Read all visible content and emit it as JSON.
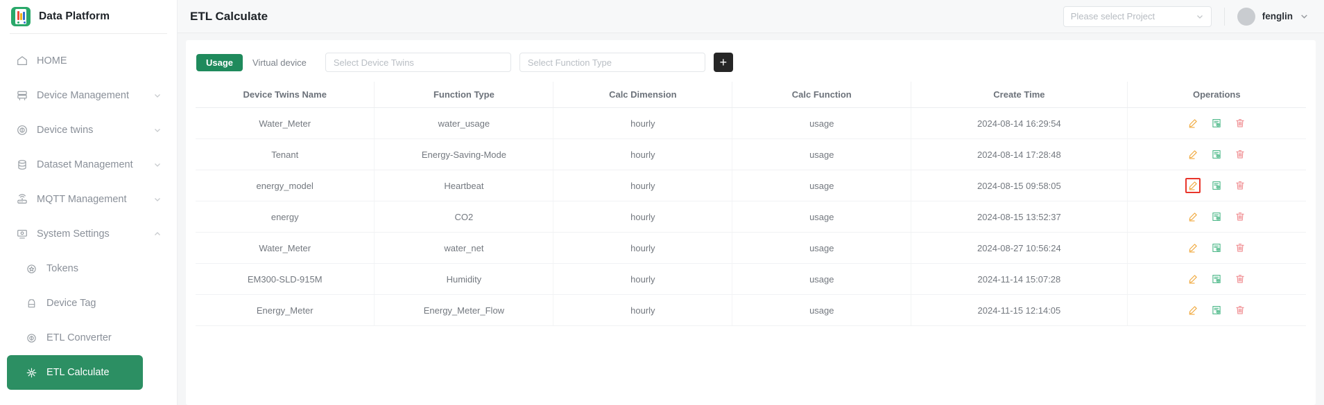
{
  "brand": {
    "title": "Data Platform",
    "logo_icon": "bar-chart-logo-icon"
  },
  "sidebar": {
    "items": [
      {
        "label": "HOME",
        "icon": "home-icon",
        "expandable": false,
        "active": false,
        "child": false
      },
      {
        "label": "Device Management",
        "icon": "server-icon",
        "expandable": true,
        "active": false,
        "child": false
      },
      {
        "label": "Device twins",
        "icon": "twins-icon",
        "expandable": true,
        "active": false,
        "child": false
      },
      {
        "label": "Dataset Management",
        "icon": "database-icon",
        "expandable": true,
        "active": false,
        "child": false
      },
      {
        "label": "MQTT Management",
        "icon": "router-icon",
        "expandable": true,
        "active": false,
        "child": false
      },
      {
        "label": "System Settings",
        "icon": "monitor-icon",
        "expandable": true,
        "active": false,
        "child": false,
        "expanded": true
      },
      {
        "label": "Tokens",
        "icon": "token-star-icon",
        "expandable": false,
        "active": false,
        "child": true
      },
      {
        "label": "Device Tag",
        "icon": "tag-icon",
        "expandable": false,
        "active": false,
        "child": true
      },
      {
        "label": "ETL Converter",
        "icon": "converter-icon",
        "expandable": false,
        "active": false,
        "child": true
      },
      {
        "label": "ETL Calculate",
        "icon": "calculate-icon",
        "expandable": false,
        "active": true,
        "child": true
      }
    ],
    "active_color": "#2c8f63"
  },
  "topbar": {
    "page_title": "ETL Calculate",
    "project_select": {
      "placeholder": "Please select Project",
      "value": ""
    },
    "user": {
      "name": "fenglin"
    }
  },
  "toolbar": {
    "tabs": [
      {
        "label": "Usage",
        "active": true
      },
      {
        "label": "Virtual device",
        "active": false
      }
    ],
    "device_twins_filter": {
      "placeholder": "Select Device Twins",
      "value": ""
    },
    "function_type_filter": {
      "placeholder": "Select Function Type",
      "value": ""
    },
    "add_button_label": "+"
  },
  "table": {
    "columns": [
      "Device Twins Name",
      "Function Type",
      "Calc Dimension",
      "Calc Function",
      "Create Time",
      "Operations"
    ],
    "rows": [
      {
        "device_twins_name": "Water_Meter",
        "function_type": "water_usage",
        "calc_dimension": "hourly",
        "calc_function": "usage",
        "create_time": "2024-08-14 16:29:54",
        "edit_highlighted": false
      },
      {
        "device_twins_name": "Tenant",
        "function_type": "Energy-Saving-Mode",
        "calc_dimension": "hourly",
        "calc_function": "usage",
        "create_time": "2024-08-14 17:28:48",
        "edit_highlighted": false
      },
      {
        "device_twins_name": "energy_model",
        "function_type": "Heartbeat",
        "calc_dimension": "hourly",
        "calc_function": "usage",
        "create_time": "2024-08-15 09:58:05",
        "edit_highlighted": true
      },
      {
        "device_twins_name": "energy",
        "function_type": "CO2",
        "calc_dimension": "hourly",
        "calc_function": "usage",
        "create_time": "2024-08-15 13:52:37",
        "edit_highlighted": false
      },
      {
        "device_twins_name": "Water_Meter",
        "function_type": "water_net",
        "calc_dimension": "hourly",
        "calc_function": "usage",
        "create_time": "2024-08-27 10:56:24",
        "edit_highlighted": false
      },
      {
        "device_twins_name": "EM300-SLD-915M",
        "function_type": "Humidity",
        "calc_dimension": "hourly",
        "calc_function": "usage",
        "create_time": "2024-11-14 15:07:28",
        "edit_highlighted": false
      },
      {
        "device_twins_name": "Energy_Meter",
        "function_type": "Energy_Meter_Flow",
        "calc_dimension": "hourly",
        "calc_function": "usage",
        "create_time": "2024-11-15 12:14:05",
        "edit_highlighted": false
      }
    ],
    "operation_icons": [
      "edit-pencil-icon",
      "view-detail-icon",
      "delete-trash-icon"
    ],
    "colors": {
      "edit": "#f0a83c",
      "view": "#4fb98a",
      "delete": "#f08d91",
      "highlight_outline": "#e8352b"
    }
  }
}
